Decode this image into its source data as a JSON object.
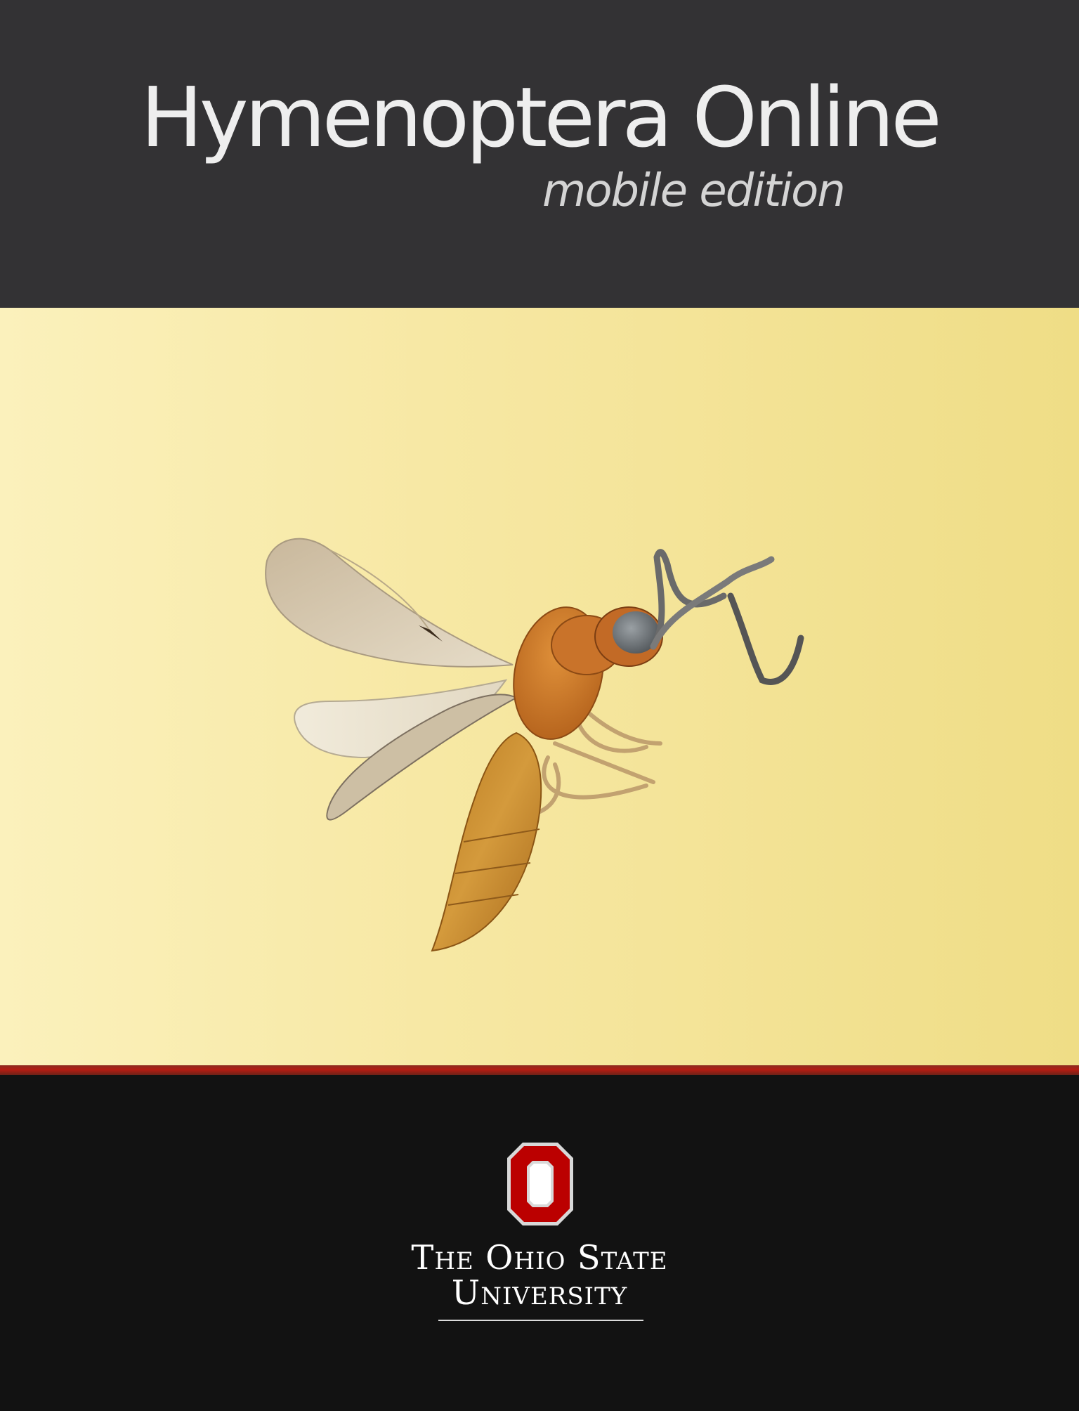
{
  "header": {
    "title": "Hymenoptera Online",
    "subtitle": "mobile edition"
  },
  "hero": {
    "image": "wasp-specimen-illustration"
  },
  "colors": {
    "header_bg": "#333234",
    "hero_bg_left": "#fbf1bc",
    "hero_bg_right": "#efdd86",
    "accent_red": "#b31c12",
    "footer_bg": "#121212"
  },
  "footer": {
    "logo": "ohio-state-block-o-icon",
    "university_line1": "The Ohio State",
    "university_line2": "University"
  }
}
